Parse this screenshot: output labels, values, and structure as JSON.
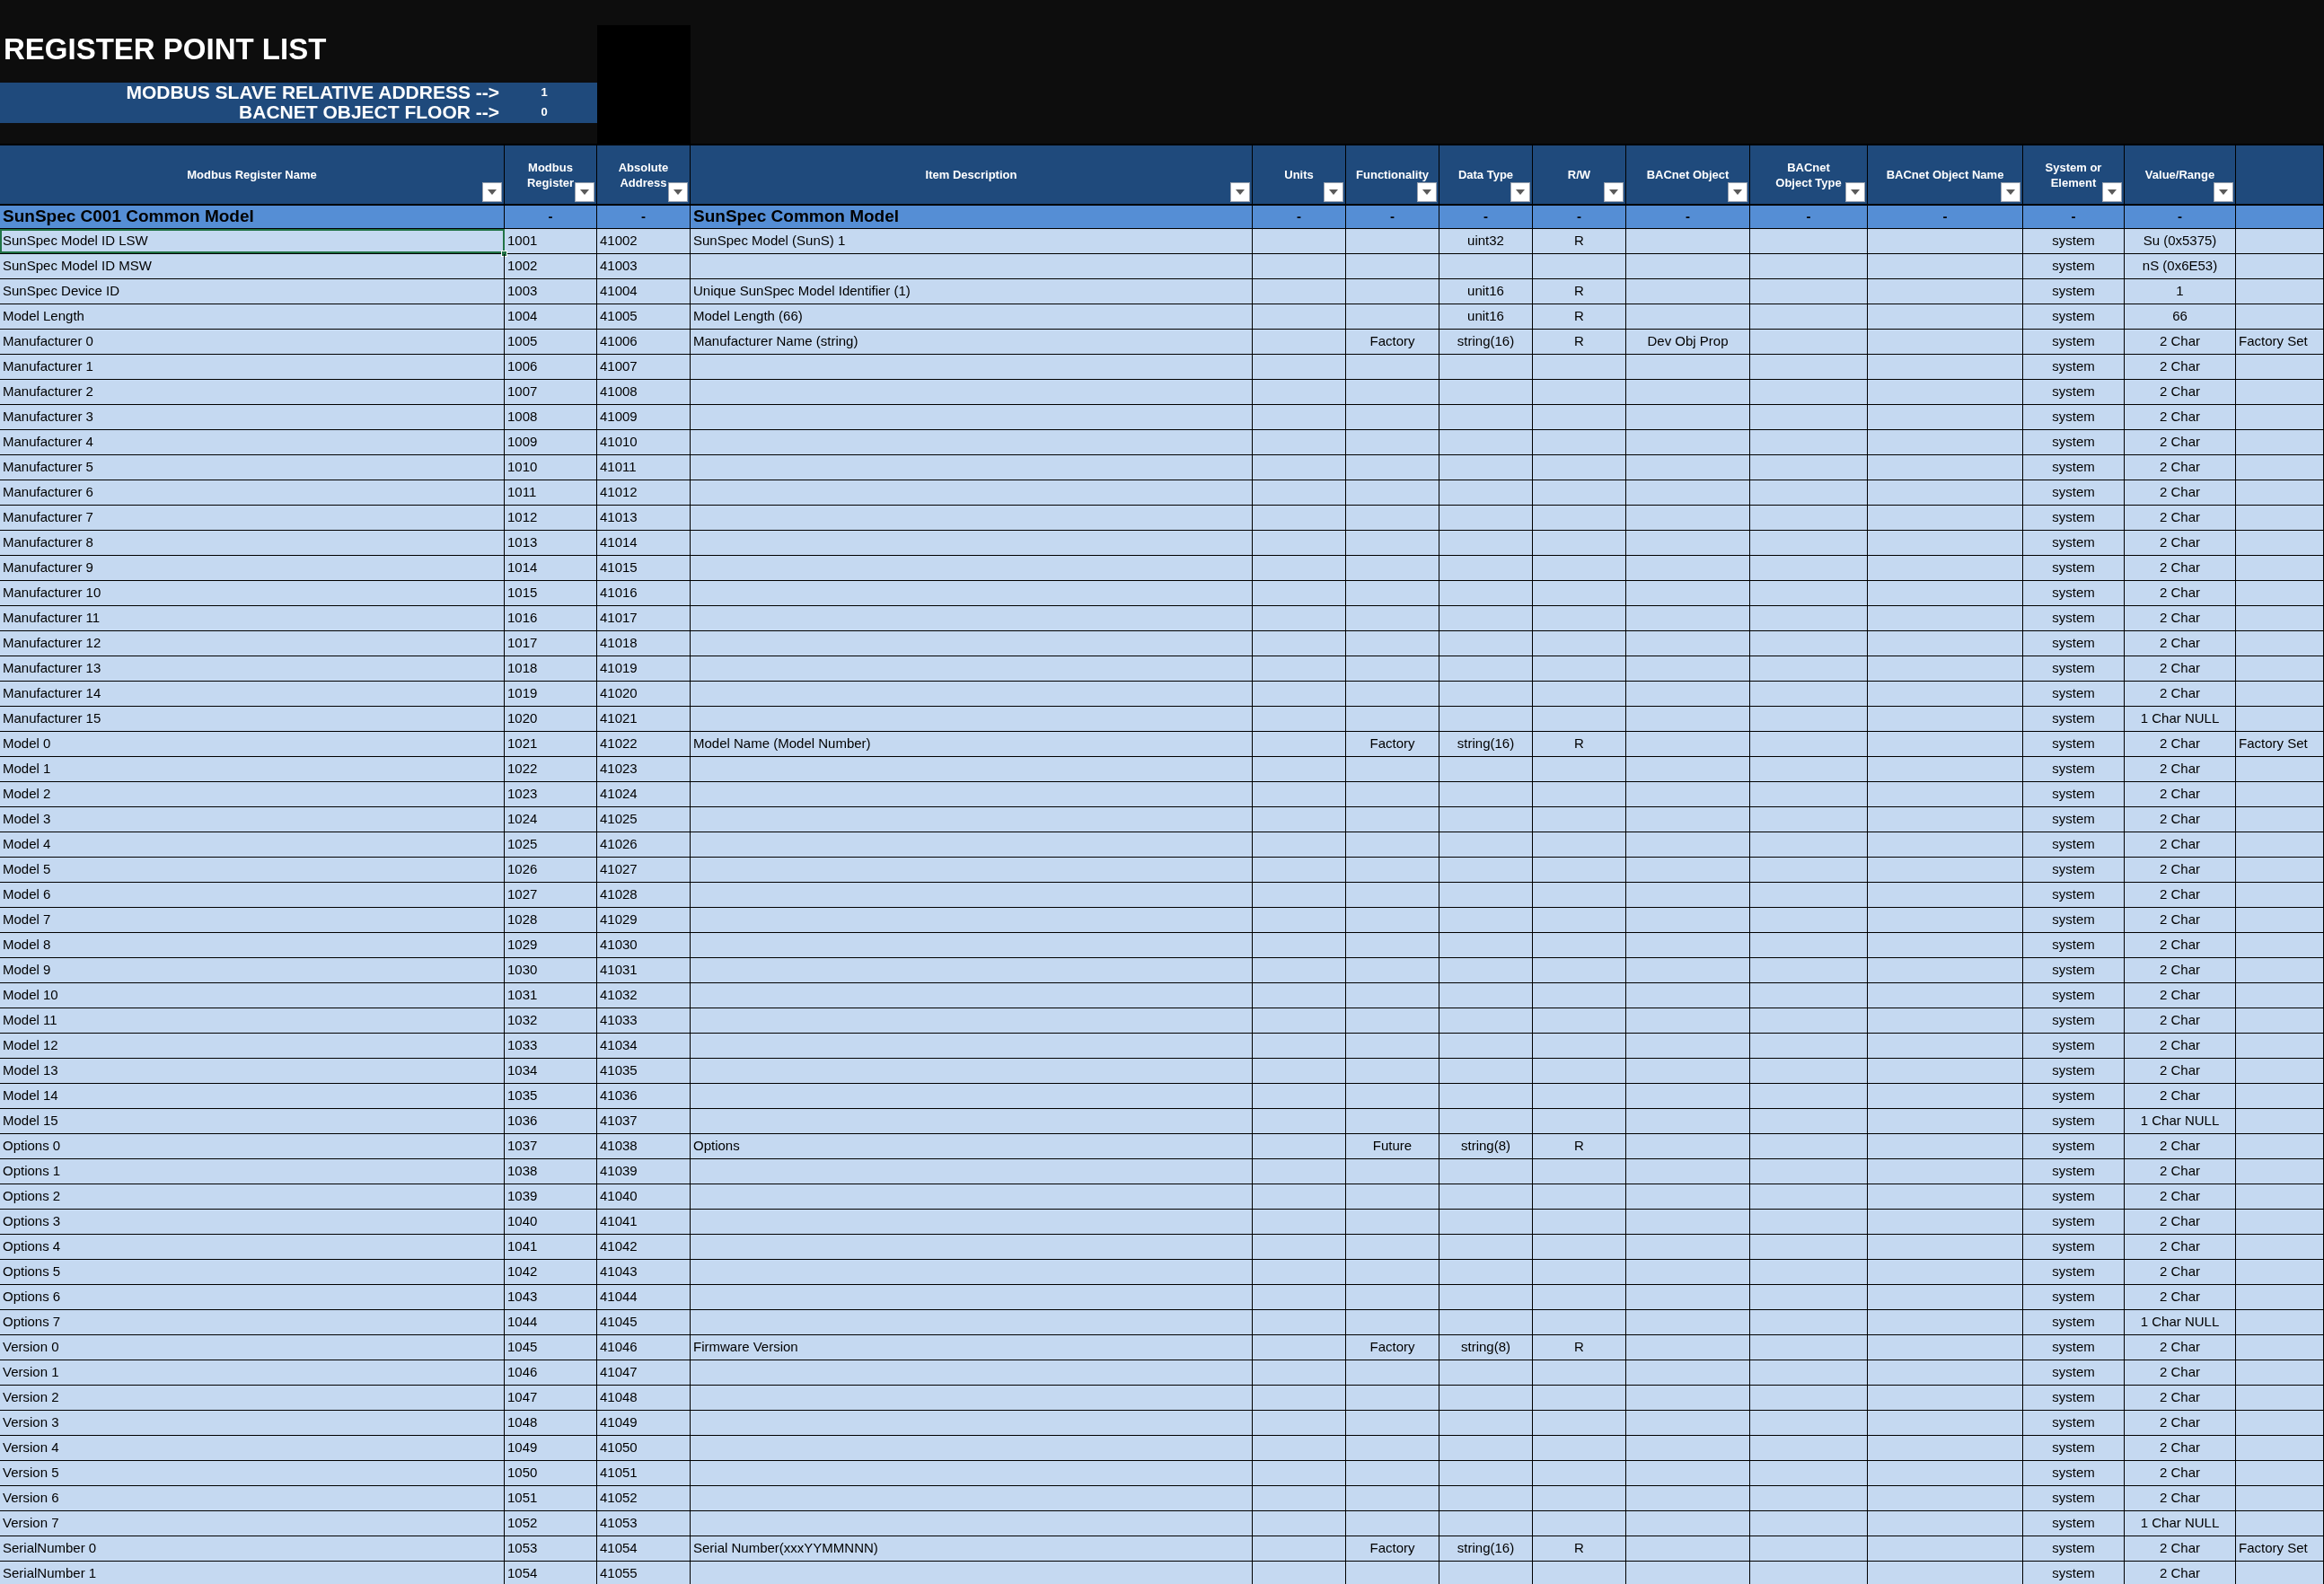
{
  "sheet": {
    "title": "REGISTER POINT LIST",
    "settings": [
      {
        "label": "MODBUS SLAVE RELATIVE ADDRESS -->",
        "value": "1"
      },
      {
        "label": "BACNET OBJECT FLOOR -->",
        "value": "0"
      }
    ]
  },
  "table": {
    "columns": [
      {
        "label": "Modbus Register Name"
      },
      {
        "label": "Modbus Register"
      },
      {
        "label": "Absolute Address"
      },
      {
        "label": "Item Description"
      },
      {
        "label": "Units"
      },
      {
        "label": "Functionality"
      },
      {
        "label": "Data Type"
      },
      {
        "label": "R/W"
      },
      {
        "label": "BACnet Object"
      },
      {
        "label": "BACnet Object Type"
      },
      {
        "label": "BACnet Object Name"
      },
      {
        "label": "System or Element"
      },
      {
        "label": "Value/Range"
      }
    ],
    "section": {
      "name": "SunSpec C001 Common Model",
      "register": "-",
      "address": "-",
      "description": "SunSpec Common Model",
      "units": "-",
      "functionality": "-",
      "data_type": "-",
      "rw": "-",
      "bacnet_object": "-",
      "bacnet_object_type": "-",
      "bacnet_object_name": "-",
      "system_or_element": "-",
      "value_range": "-"
    },
    "rows": [
      {
        "selected": true,
        "name": "SunSpec Model ID LSW",
        "register": "1001",
        "address": "41002",
        "description": "SunSpec Model (SunS) 1",
        "data_type": "uint32",
        "rw": "R",
        "system_or_element": "system",
        "value_range": "Su (0x5375)"
      },
      {
        "selected": false,
        "name": "SunSpec Model ID MSW",
        "register": "1002",
        "address": "41003",
        "system_or_element": "system",
        "value_range": "nS (0x6E53)"
      },
      {
        "selected": false,
        "name": "SunSpec Device ID",
        "register": "1003",
        "address": "41004",
        "description": "Unique SunSpec Model Identifier (1)",
        "data_type": "unit16",
        "rw": "R",
        "system_or_element": "system",
        "value_range": "1"
      },
      {
        "selected": false,
        "name": "Model Length",
        "register": "1004",
        "address": "41005",
        "description": "Model Length (66)",
        "data_type": "unit16",
        "rw": "R",
        "system_or_element": "system",
        "value_range": "66"
      },
      {
        "selected": false,
        "name": "Manufacturer 0",
        "register": "1005",
        "address": "41006",
        "description": "Manufacturer Name (string)",
        "functionality": "Factory",
        "data_type": "string(16)",
        "rw": "R",
        "bacnet_object": "Dev Obj Prop",
        "system_or_element": "system",
        "value_range": "2 Char",
        "column_14": "Factory Set"
      },
      {
        "selected": false,
        "name": "Manufacturer 1",
        "register": "1006",
        "address": "41007",
        "system_or_element": "system",
        "value_range": "2 Char"
      },
      {
        "selected": false,
        "name": "Manufacturer 2",
        "register": "1007",
        "address": "41008",
        "system_or_element": "system",
        "value_range": "2 Char"
      },
      {
        "selected": false,
        "name": "Manufacturer 3",
        "register": "1008",
        "address": "41009",
        "system_or_element": "system",
        "value_range": "2 Char"
      },
      {
        "selected": false,
        "name": "Manufacturer 4",
        "register": "1009",
        "address": "41010",
        "system_or_element": "system",
        "value_range": "2 Char"
      },
      {
        "selected": false,
        "name": "Manufacturer 5",
        "register": "1010",
        "address": "41011",
        "system_or_element": "system",
        "value_range": "2 Char"
      },
      {
        "selected": false,
        "name": "Manufacturer 6",
        "register": "1011",
        "address": "41012",
        "system_or_element": "system",
        "value_range": "2 Char"
      },
      {
        "selected": false,
        "name": "Manufacturer 7",
        "register": "1012",
        "address": "41013",
        "system_or_element": "system",
        "value_range": "2 Char"
      },
      {
        "selected": false,
        "name": "Manufacturer 8",
        "register": "1013",
        "address": "41014",
        "system_or_element": "system",
        "value_range": "2 Char"
      },
      {
        "selected": false,
        "name": "Manufacturer 9",
        "register": "1014",
        "address": "41015",
        "system_or_element": "system",
        "value_range": "2 Char"
      },
      {
        "selected": false,
        "name": "Manufacturer 10",
        "register": "1015",
        "address": "41016",
        "system_or_element": "system",
        "value_range": "2 Char"
      },
      {
        "selected": false,
        "name": "Manufacturer 11",
        "register": "1016",
        "address": "41017",
        "system_or_element": "system",
        "value_range": "2 Char"
      },
      {
        "selected": false,
        "name": "Manufacturer 12",
        "register": "1017",
        "address": "41018",
        "system_or_element": "system",
        "value_range": "2 Char"
      },
      {
        "selected": false,
        "name": "Manufacturer 13",
        "register": "1018",
        "address": "41019",
        "system_or_element": "system",
        "value_range": "2 Char"
      },
      {
        "selected": false,
        "name": "Manufacturer 14",
        "register": "1019",
        "address": "41020",
        "system_or_element": "system",
        "value_range": "2 Char"
      },
      {
        "selected": false,
        "name": "Manufacturer 15",
        "register": "1020",
        "address": "41021",
        "system_or_element": "system",
        "value_range": "1 Char NULL"
      },
      {
        "selected": false,
        "name": "Model 0",
        "register": "1021",
        "address": "41022",
        "description": "Model Name (Model Number)",
        "functionality": "Factory",
        "data_type": "string(16)",
        "rw": "R",
        "system_or_element": "system",
        "value_range": "2 Char",
        "column_14": "Factory Set"
      },
      {
        "selected": false,
        "name": "Model 1",
        "register": "1022",
        "address": "41023",
        "system_or_element": "system",
        "value_range": "2 Char"
      },
      {
        "selected": false,
        "name": "Model 2",
        "register": "1023",
        "address": "41024",
        "system_or_element": "system",
        "value_range": "2 Char"
      },
      {
        "selected": false,
        "name": "Model 3",
        "register": "1024",
        "address": "41025",
        "system_or_element": "system",
        "value_range": "2 Char"
      },
      {
        "selected": false,
        "name": "Model 4",
        "register": "1025",
        "address": "41026",
        "system_or_element": "system",
        "value_range": "2 Char"
      },
      {
        "selected": false,
        "name": "Model 5",
        "register": "1026",
        "address": "41027",
        "system_or_element": "system",
        "value_range": "2 Char"
      },
      {
        "selected": false,
        "name": "Model 6",
        "register": "1027",
        "address": "41028",
        "system_or_element": "system",
        "value_range": "2 Char"
      },
      {
        "selected": false,
        "name": "Model 7",
        "register": "1028",
        "address": "41029",
        "system_or_element": "system",
        "value_range": "2 Char"
      },
      {
        "selected": false,
        "name": "Model 8",
        "register": "1029",
        "address": "41030",
        "system_or_element": "system",
        "value_range": "2 Char"
      },
      {
        "selected": false,
        "name": "Model 9",
        "register": "1030",
        "address": "41031",
        "system_or_element": "system",
        "value_range": "2 Char"
      },
      {
        "selected": false,
        "name": "Model 10",
        "register": "1031",
        "address": "41032",
        "system_or_element": "system",
        "value_range": "2 Char"
      },
      {
        "selected": false,
        "name": "Model 11",
        "register": "1032",
        "address": "41033",
        "system_or_element": "system",
        "value_range": "2 Char"
      },
      {
        "selected": false,
        "name": "Model 12",
        "register": "1033",
        "address": "41034",
        "system_or_element": "system",
        "value_range": "2 Char"
      },
      {
        "selected": false,
        "name": "Model 13",
        "register": "1034",
        "address": "41035",
        "system_or_element": "system",
        "value_range": "2 Char"
      },
      {
        "selected": false,
        "name": "Model 14",
        "register": "1035",
        "address": "41036",
        "system_or_element": "system",
        "value_range": "2 Char"
      },
      {
        "selected": false,
        "name": "Model 15",
        "register": "1036",
        "address": "41037",
        "system_or_element": "system",
        "value_range": "1 Char NULL"
      },
      {
        "selected": false,
        "name": "Options 0",
        "register": "1037",
        "address": "41038",
        "description": "Options",
        "functionality": "Future",
        "data_type": "string(8)",
        "rw": "R",
        "system_or_element": "system",
        "value_range": "2 Char"
      },
      {
        "selected": false,
        "name": "Options 1",
        "register": "1038",
        "address": "41039",
        "system_or_element": "system",
        "value_range": "2 Char"
      },
      {
        "selected": false,
        "name": "Options 2",
        "register": "1039",
        "address": "41040",
        "system_or_element": "system",
        "value_range": "2 Char"
      },
      {
        "selected": false,
        "name": "Options 3",
        "register": "1040",
        "address": "41041",
        "system_or_element": "system",
        "value_range": "2 Char"
      },
      {
        "selected": false,
        "name": "Options 4",
        "register": "1041",
        "address": "41042",
        "system_or_element": "system",
        "value_range": "2 Char"
      },
      {
        "selected": false,
        "name": "Options 5",
        "register": "1042",
        "address": "41043",
        "system_or_element": "system",
        "value_range": "2 Char"
      },
      {
        "selected": false,
        "name": "Options 6",
        "register": "1043",
        "address": "41044",
        "system_or_element": "system",
        "value_range": "2 Char"
      },
      {
        "selected": false,
        "name": "Options 7",
        "register": "1044",
        "address": "41045",
        "system_or_element": "system",
        "value_range": "1 Char NULL"
      },
      {
        "selected": false,
        "name": "Version 0",
        "register": "1045",
        "address": "41046",
        "description": "Firmware Version",
        "functionality": "Factory",
        "data_type": "string(8)",
        "rw": "R",
        "system_or_element": "system",
        "value_range": "2 Char"
      },
      {
        "selected": false,
        "name": "Version 1",
        "register": "1046",
        "address": "41047",
        "system_or_element": "system",
        "value_range": "2 Char"
      },
      {
        "selected": false,
        "name": "Version 2",
        "register": "1047",
        "address": "41048",
        "system_or_element": "system",
        "value_range": "2 Char"
      },
      {
        "selected": false,
        "name": "Version 3",
        "register": "1048",
        "address": "41049",
        "system_or_element": "system",
        "value_range": "2 Char"
      },
      {
        "selected": false,
        "name": "Version 4",
        "register": "1049",
        "address": "41050",
        "system_or_element": "system",
        "value_range": "2 Char"
      },
      {
        "selected": false,
        "name": "Version 5",
        "register": "1050",
        "address": "41051",
        "system_or_element": "system",
        "value_range": "2 Char"
      },
      {
        "selected": false,
        "name": "Version 6",
        "register": "1051",
        "address": "41052",
        "system_or_element": "system",
        "value_range": "2 Char"
      },
      {
        "selected": false,
        "name": "Version 7",
        "register": "1052",
        "address": "41053",
        "system_or_element": "system",
        "value_range": "1 Char NULL"
      },
      {
        "selected": false,
        "name": "SerialNumber 0",
        "register": "1053",
        "address": "41054",
        "description": "Serial Number(xxxYYMMNNN)",
        "functionality": "Factory",
        "data_type": "string(16)",
        "rw": "R",
        "system_or_element": "system",
        "value_range": "2 Char",
        "column_14": "Factory Set"
      },
      {
        "selected": false,
        "name": "SerialNumber 1",
        "register": "1054",
        "address": "41055",
        "system_or_element": "system",
        "value_range": "2 Char"
      }
    ]
  }
}
